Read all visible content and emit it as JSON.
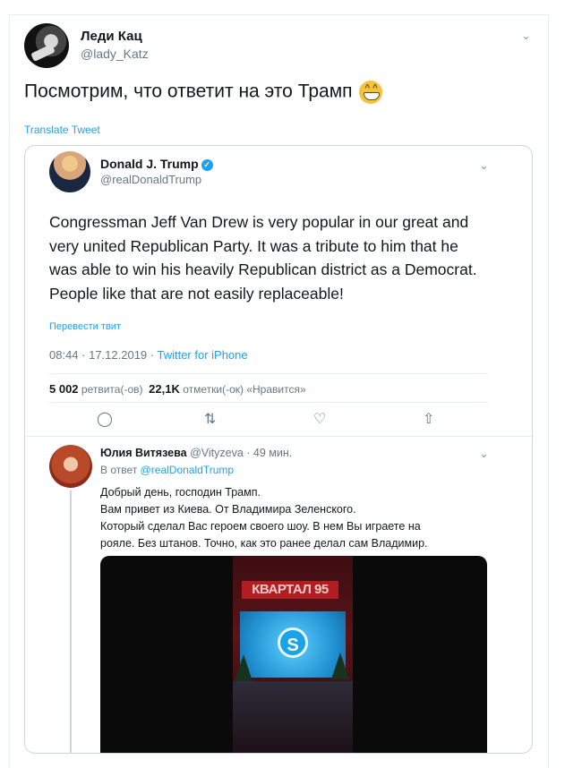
{
  "tweet": {
    "author_name": "Леди Кац",
    "author_handle": "@lady_Katz",
    "text": "Посмотрим, что ответит на это Трамп",
    "emoji_icon": "grinning-face-icon",
    "translate_label": "Translate Tweet"
  },
  "quoted": {
    "author_name": "Donald J. Trump",
    "author_handle": "@realDonaldTrump",
    "text_lines": [
      "Congressman Jeff Van Drew is very popular in our great and",
      "very united Republican Party. It was a tribute to him that he",
      "was able to win his heavily Republican district as a Democrat.",
      "People like that are not easily replaceable!"
    ],
    "translate_label": "Перевести твит",
    "time": "08:44 · 17.12.2019 · ",
    "source": "Twitter for iPhone",
    "retweets_count": "5 002",
    "retweets_label": "ретвита(-ов)",
    "likes_count": "22,1K",
    "likes_label": "отметки(-ок) «Нравится»"
  },
  "reply": {
    "author_name": "Юлия Витязева",
    "author_handle": "@Vityzeva · 49 мин.",
    "reply_to_prefix": "В ответ ",
    "reply_to_mention": "@realDonaldTrump",
    "text_lines": [
      "Добрый день, господин Трамп.",
      "Вам привет из Киева. От Владимира Зеленского.",
      "Который сделал Вас героем своего шоу. В нем Вы играете на",
      "рояле. Без штанов. Точно, как это ранее делал сам Владимир."
    ],
    "video_sign": "КВАРТАЛ 95",
    "video_logo": "S"
  },
  "colors": {
    "link": "#1da1f2",
    "secondary_text": "#657786",
    "border": "#ccd6dd"
  }
}
